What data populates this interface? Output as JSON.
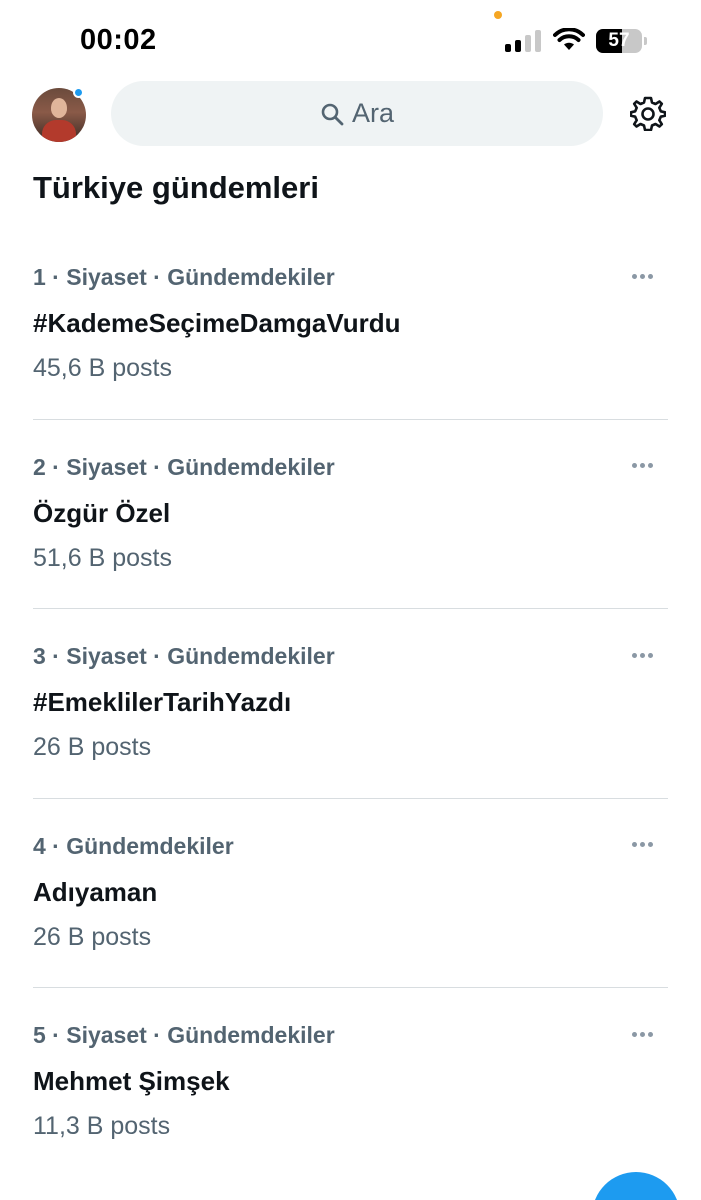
{
  "status_bar": {
    "time": "00:02",
    "battery_level": "57",
    "battery_fraction": 0.57
  },
  "header": {
    "search": {
      "placeholder": "Ara"
    },
    "avatar_alt": "avatar",
    "has_notification": true
  },
  "section": {
    "title": "Türkiye gündemleri"
  },
  "trends": [
    {
      "meta": "1 · Siyaset · Gündemdekiler",
      "name": "#KademeSeçimeDamgaVurdu",
      "count": "45,6 B posts"
    },
    {
      "meta": "2 · Siyaset · Gündemdekiler",
      "name": "Özgür Özel",
      "count": "51,6 B posts"
    },
    {
      "meta": "3 · Siyaset · Gündemdekiler",
      "name": "#EmeklilerTarihYazdı",
      "count": "26 B posts"
    },
    {
      "meta": "4 · Gündemdekiler",
      "name": "Adıyaman",
      "count": "26 B posts"
    },
    {
      "meta": "5 · Siyaset · Gündemdekiler",
      "name": "Mehmet Şimşek",
      "count": "11,3 B posts"
    }
  ],
  "colors": {
    "accent": "#1d9bf0",
    "secondary_text": "#536471",
    "search_bg": "#eff3f4"
  },
  "icons": [
    "search-icon",
    "gear-icon",
    "more-icon",
    "wifi-icon",
    "signal-icon",
    "battery-icon",
    "compose-button"
  ]
}
